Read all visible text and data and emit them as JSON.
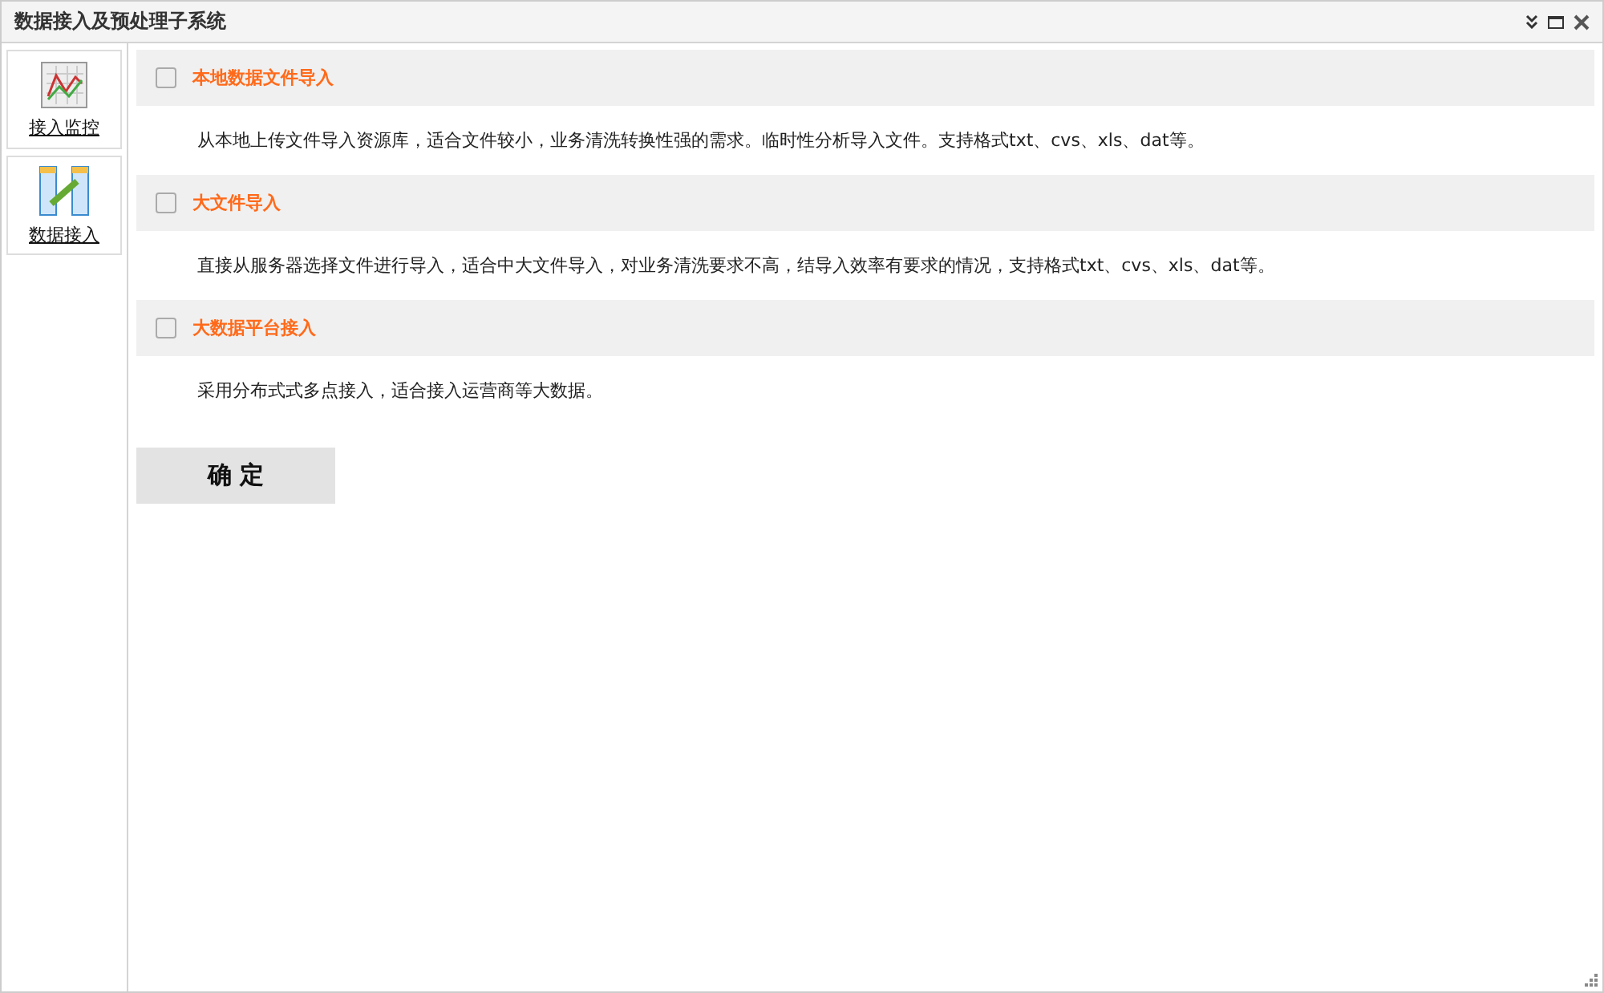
{
  "window": {
    "title": "数据接入及预处理子系统"
  },
  "sidebar": {
    "items": [
      {
        "kind": "monitor",
        "label": "接入监控"
      },
      {
        "kind": "import",
        "label": "数据接入"
      }
    ]
  },
  "sections": [
    {
      "title": "本地数据文件导入",
      "checked": false,
      "description": "从本地上传文件导入资源库，适合文件较小，业务清洗转换性强的需求。临时性分析导入文件。支持格式txt、cvs、xls、dat等。"
    },
    {
      "title": "大文件导入",
      "checked": false,
      "description": "直接从服务器选择文件进行导入，适合中大文件导入，对业务清洗要求不高，结导入效率有要求的情况，支持格式txt、cvs、xls、dat等。"
    },
    {
      "title": "大数据平台接入",
      "checked": false,
      "description": "采用分布式式多点接入，适合接入运营商等大数据。"
    }
  ],
  "confirm_button": "确 定"
}
